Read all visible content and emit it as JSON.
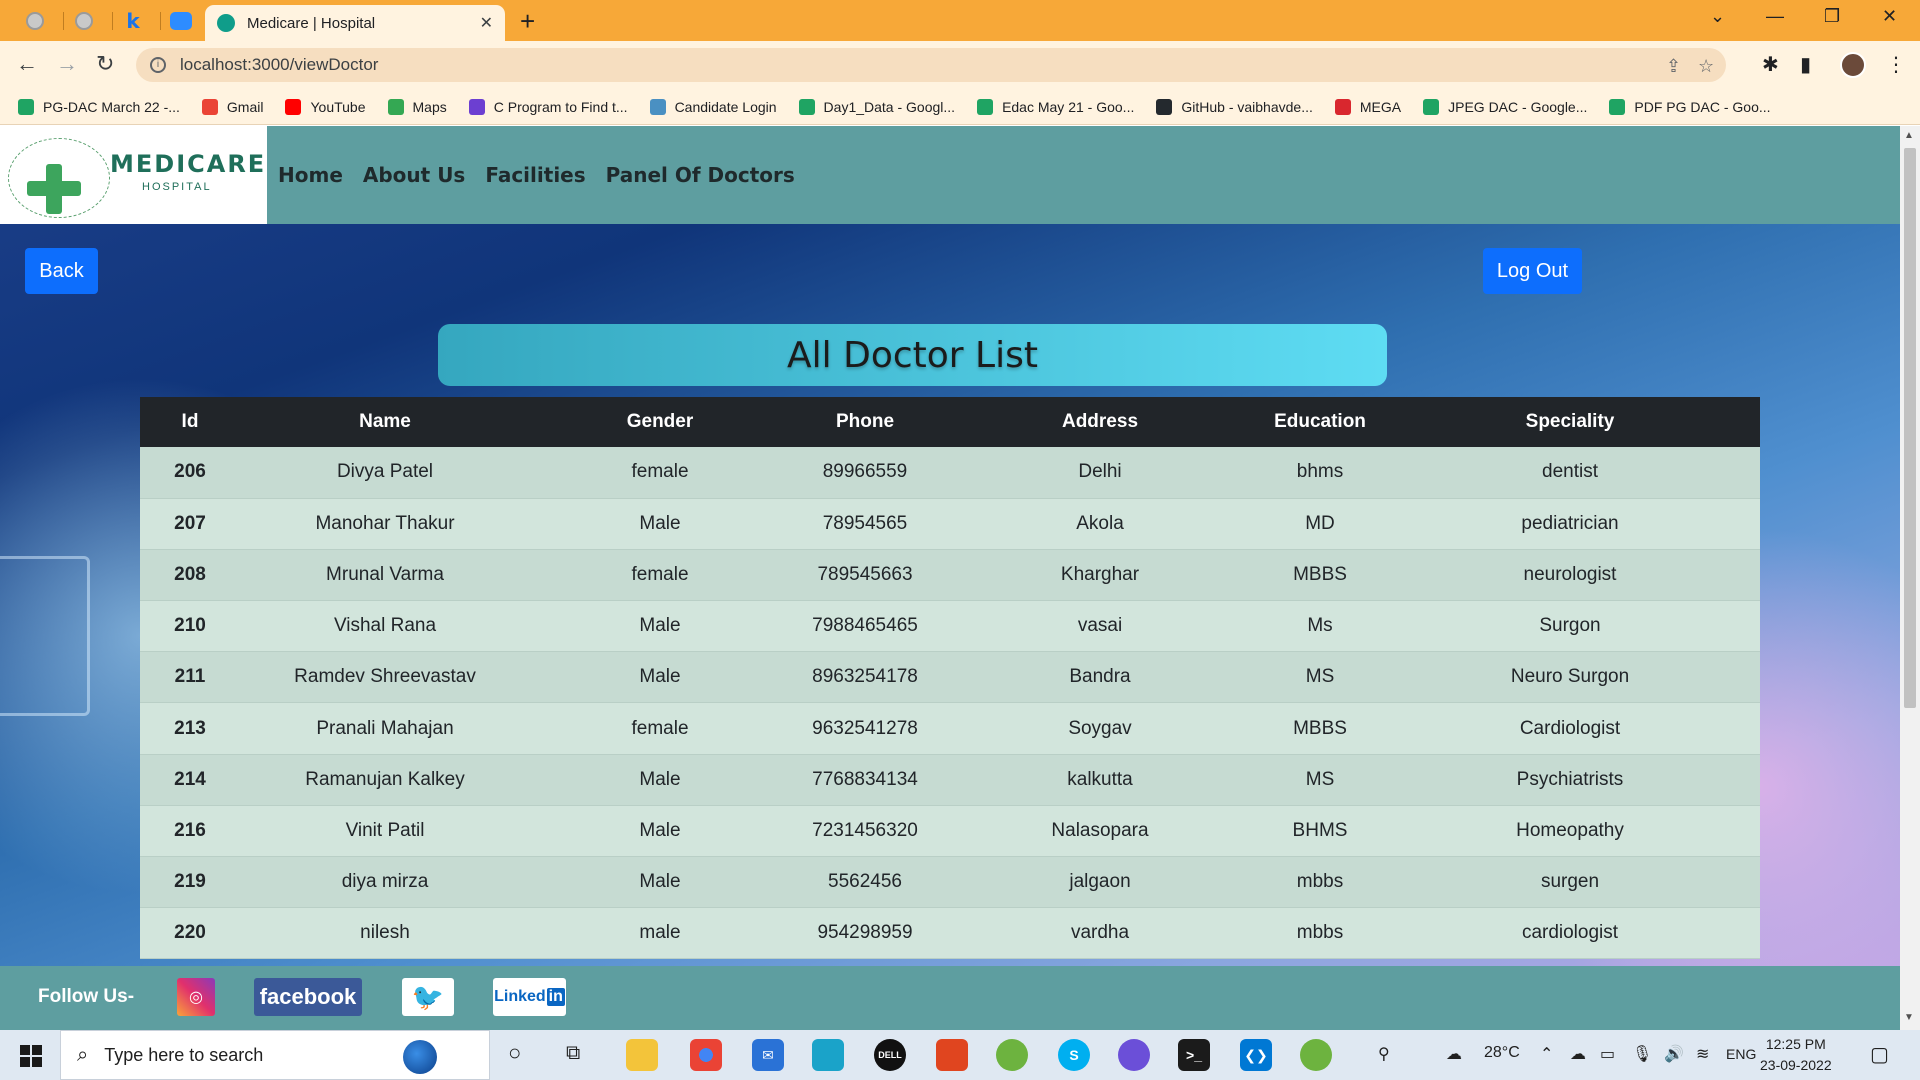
{
  "browser": {
    "tab_title": "Medicare | Hospital",
    "url": "localhost:3000/viewDoctor",
    "bookmarks": [
      {
        "label": "PG-DAC March 22 -...",
        "color": "#1fa463"
      },
      {
        "label": "Gmail",
        "color": "#ea4335"
      },
      {
        "label": "YouTube",
        "color": "#ff0000"
      },
      {
        "label": "Maps",
        "color": "#34a853"
      },
      {
        "label": "C Program to Find t...",
        "color": "#6c3fd1"
      },
      {
        "label": "Candidate Login",
        "color": "#4a90c2"
      },
      {
        "label": "Day1_Data - Googl...",
        "color": "#1fa463"
      },
      {
        "label": "Edac May 21 - Goo...",
        "color": "#1fa463"
      },
      {
        "label": "GitHub - vaibhavde...",
        "color": "#24292e"
      },
      {
        "label": "MEGA",
        "color": "#d9272e"
      },
      {
        "label": "JPEG DAC - Google...",
        "color": "#1fa463"
      },
      {
        "label": "PDF PG DAC - Goo...",
        "color": "#1fa463"
      }
    ]
  },
  "site": {
    "logo_name": "MEDICARE",
    "logo_sub": "HOSPITAL",
    "nav": [
      "Home",
      "About Us",
      "Facilities",
      "Panel Of Doctors"
    ],
    "back_label": "Back",
    "logout_label": "Log Out",
    "page_title": "All Doctor List",
    "follow_label": "Follow Us-",
    "social": [
      "facebook",
      "Linked"
    ]
  },
  "table": {
    "headers": [
      "Id",
      "Name",
      "Gender",
      "Phone",
      "Address",
      "Education",
      "Speciality"
    ],
    "rows": [
      [
        "206",
        "Divya Patel",
        "female",
        "89966559",
        "Delhi",
        "bhms",
        "dentist"
      ],
      [
        "207",
        "Manohar Thakur",
        "Male",
        "78954565",
        "Akola",
        "MD",
        "pediatrician"
      ],
      [
        "208",
        "Mrunal Varma",
        "female",
        "789545663",
        "Kharghar",
        "MBBS",
        "neurologist"
      ],
      [
        "210",
        "Vishal Rana",
        "Male",
        "7988465465",
        "vasai",
        "Ms",
        "Surgon"
      ],
      [
        "211",
        "Ramdev Shreevastav",
        "Male",
        "8963254178",
        "Bandra",
        "MS",
        "Neuro Surgon"
      ],
      [
        "213",
        "Pranali Mahajan",
        "female",
        "9632541278",
        "Soygav",
        "MBBS",
        "Cardiologist"
      ],
      [
        "214",
        "Ramanujan Kalkey",
        "Male",
        "7768834134",
        "kalkutta",
        "MS",
        "Psychiatrists"
      ],
      [
        "216",
        "Vinit Patil",
        "Male",
        "7231456320",
        "Nalasopara",
        "BHMS",
        "Homeopathy"
      ],
      [
        "219",
        "diya mirza",
        "Male",
        "5562456",
        "jalgaon",
        "mbbs",
        "surgen"
      ],
      [
        "220",
        "nilesh",
        "male",
        "954298959",
        "vardha",
        "mbbs",
        "cardiologist"
      ]
    ]
  },
  "taskbar": {
    "search_placeholder": "Type here to search",
    "weather": "28°C",
    "lang": "ENG",
    "time": "12:25 PM",
    "date": "23-09-2022"
  },
  "colors": {
    "tabbar": "#f7a838",
    "nav": "#5e9ea0",
    "button": "#0d6efd",
    "table_head": "#212529"
  }
}
